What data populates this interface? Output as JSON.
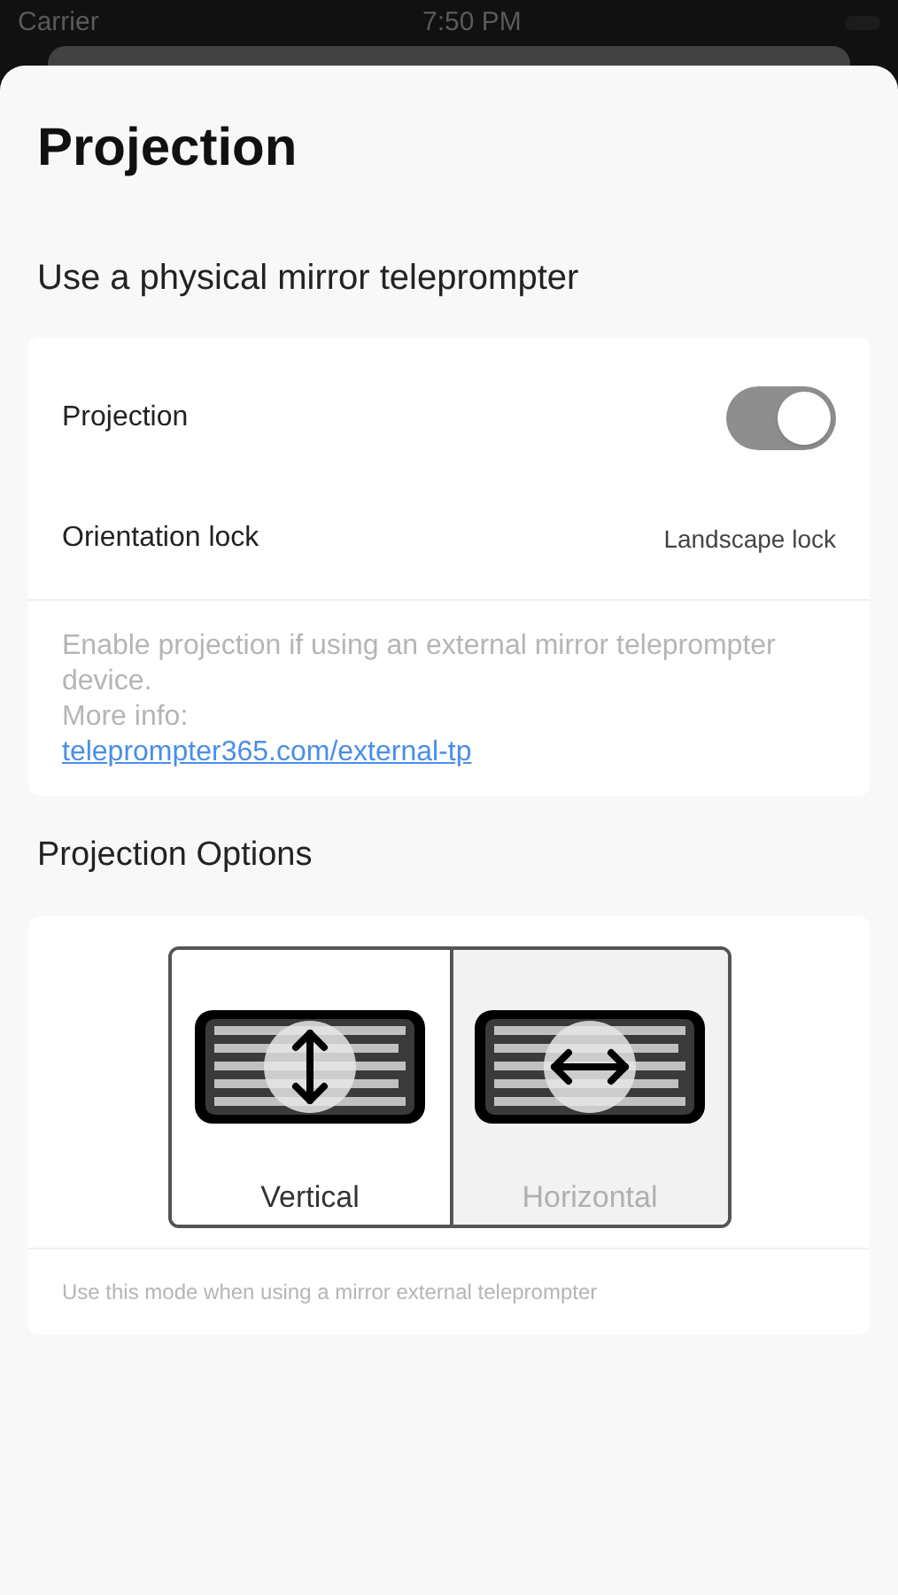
{
  "status_bar": {
    "carrier": "Carrier",
    "time": "7:50 PM"
  },
  "title": "Projection",
  "section_heading": "Use a physical mirror teleprompter",
  "settings": [
    {
      "kind": "toggle",
      "label": "Projection",
      "on": true
    },
    {
      "kind": "value",
      "label": "Orientation lock",
      "value": "Landscape lock"
    }
  ],
  "description": {
    "text": "Enable projection if using an external mirror teleprompter device.",
    "more_info": "More info:",
    "link": "teleprompter365.com/external-tp"
  },
  "options_heading": "Projection Options",
  "options": [
    {
      "label": "Vertical",
      "kind": "vertical",
      "selected": true
    },
    {
      "label": "Horizontal",
      "kind": "horizontal",
      "selected": false
    }
  ],
  "options_note": "Use this mode when using a mirror external teleprompter"
}
